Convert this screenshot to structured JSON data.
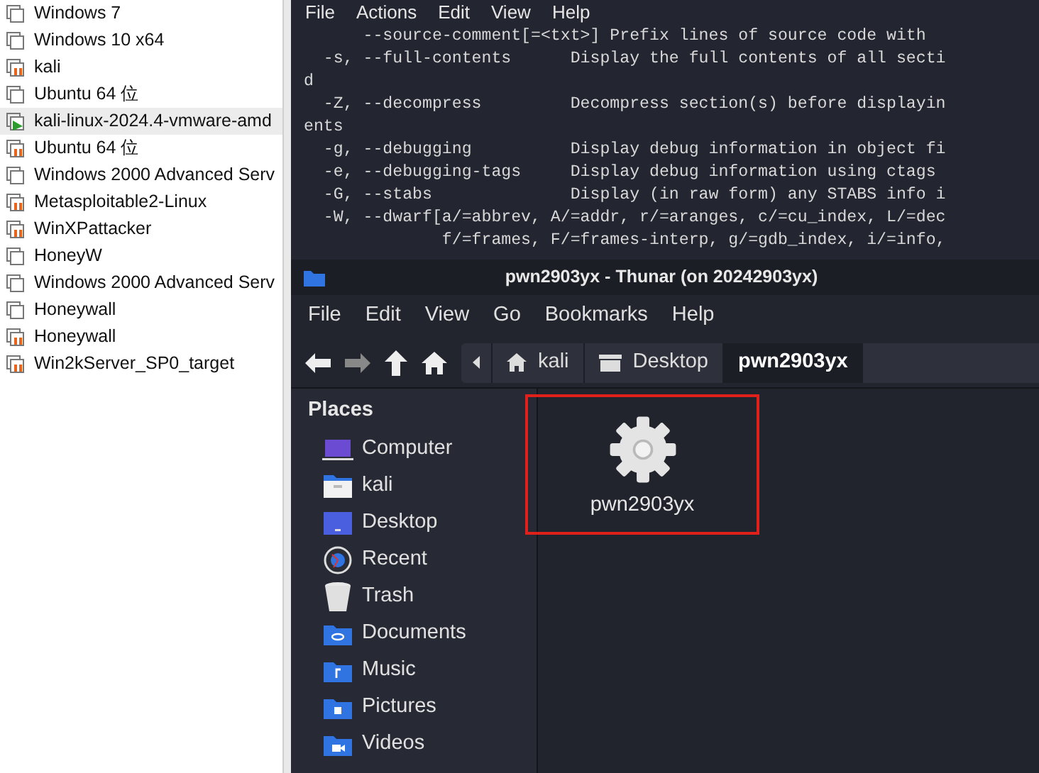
{
  "vm_library": {
    "items": [
      {
        "name": "Windows 7",
        "running": false,
        "suspended": false,
        "selected": false
      },
      {
        "name": "Windows 10 x64",
        "running": false,
        "suspended": false,
        "selected": false
      },
      {
        "name": "kali",
        "running": false,
        "suspended": true,
        "selected": false
      },
      {
        "name": "Ubuntu 64 位",
        "running": false,
        "suspended": false,
        "selected": false
      },
      {
        "name": "kali-linux-2024.4-vmware-amd",
        "running": true,
        "suspended": false,
        "selected": true
      },
      {
        "name": "Ubuntu 64 位",
        "running": false,
        "suspended": true,
        "selected": false
      },
      {
        "name": "Windows 2000 Advanced Serv",
        "running": false,
        "suspended": false,
        "selected": false
      },
      {
        "name": "Metasploitable2-Linux",
        "running": false,
        "suspended": true,
        "selected": false
      },
      {
        "name": "WinXPattacker",
        "running": false,
        "suspended": true,
        "selected": false
      },
      {
        "name": "HoneyW",
        "running": false,
        "suspended": false,
        "selected": false
      },
      {
        "name": "Windows 2000 Advanced Serv",
        "running": false,
        "suspended": false,
        "selected": false
      },
      {
        "name": "Honeywall",
        "running": false,
        "suspended": false,
        "selected": false
      },
      {
        "name": "Honeywall",
        "running": false,
        "suspended": true,
        "selected": false
      },
      {
        "name": "Win2kServer_SP0_target",
        "running": false,
        "suspended": true,
        "selected": false
      }
    ]
  },
  "terminal": {
    "menu": [
      "File",
      "Actions",
      "Edit",
      "View",
      "Help"
    ],
    "lines": [
      "      --source-comment[=<txt>] Prefix lines of source code with",
      "  -s, --full-contents      Display the full contents of all secti",
      "d",
      "  -Z, --decompress         Decompress section(s) before displayin",
      "ents",
      "  -g, --debugging          Display debug information in object fi",
      "  -e, --debugging-tags     Display debug information using ctags",
      "  -G, --stabs              Display (in raw form) any STABS info i",
      "  -W, --dwarf[a/=abbrev, A/=addr, r/=aranges, c/=cu_index, L/=dec",
      "              f/=frames, F/=frames-interp, g/=gdb_index, i/=info,"
    ]
  },
  "file_manager": {
    "title": "pwn2903yx - Thunar (on 20242903yx)",
    "menu": [
      "File",
      "Edit",
      "View",
      "Go",
      "Bookmarks",
      "Help"
    ],
    "path": [
      {
        "label": "kali",
        "kind": "home",
        "selected": false
      },
      {
        "label": "Desktop",
        "kind": "desktop",
        "selected": false
      },
      {
        "label": "pwn2903yx",
        "kind": "folder",
        "selected": true
      }
    ],
    "places_title": "Places",
    "places": [
      {
        "label": "Computer",
        "kind": "computer"
      },
      {
        "label": "kali",
        "kind": "home"
      },
      {
        "label": "Desktop",
        "kind": "desktop"
      },
      {
        "label": "Recent",
        "kind": "recent"
      },
      {
        "label": "Trash",
        "kind": "trash"
      },
      {
        "label": "Documents",
        "kind": "documents"
      },
      {
        "label": "Music",
        "kind": "music"
      },
      {
        "label": "Pictures",
        "kind": "pictures"
      },
      {
        "label": "Videos",
        "kind": "videos"
      }
    ],
    "files": [
      {
        "name": "pwn2903yx",
        "highlighted": true
      }
    ]
  }
}
